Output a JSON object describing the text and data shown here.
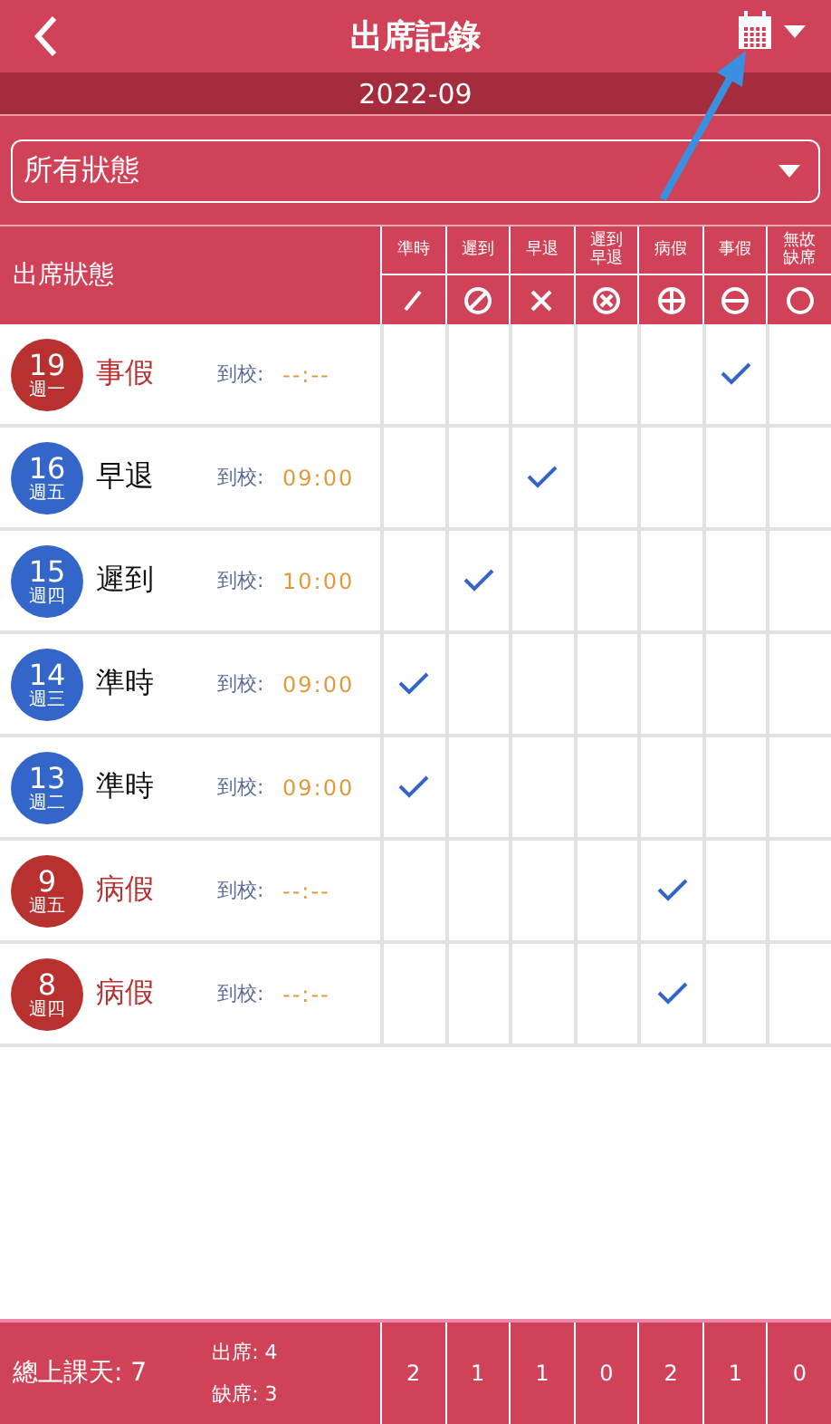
{
  "header": {
    "title": "出席記錄"
  },
  "month": "2022-09",
  "filter": {
    "value": "所有狀態"
  },
  "table": {
    "status_heading": "出席狀態",
    "columns": [
      {
        "label": "準時",
        "kind": "slash"
      },
      {
        "label": "遲到",
        "kind": "prohibit"
      },
      {
        "label": "早退",
        "kind": "cross"
      },
      {
        "label": "遲到早退",
        "kind": "circlecross"
      },
      {
        "label": "病假",
        "kind": "circleplus"
      },
      {
        "label": "事假",
        "kind": "circleminus"
      },
      {
        "label": "無故缺席",
        "kind": "circle"
      }
    ],
    "rows": [
      {
        "day": "19",
        "weekday": "週一",
        "status": "事假",
        "kind": "leave",
        "color": "#b8312f",
        "arrive_label": "到校:",
        "arrive_time": "--:--",
        "marks": [
          false,
          false,
          false,
          false,
          false,
          true,
          false
        ]
      },
      {
        "day": "16",
        "weekday": "週五",
        "status": "早退",
        "kind": "present",
        "color": "#3465c9",
        "arrive_label": "到校:",
        "arrive_time": "09:00",
        "marks": [
          false,
          false,
          true,
          false,
          false,
          false,
          false
        ]
      },
      {
        "day": "15",
        "weekday": "週四",
        "status": "遲到",
        "kind": "present",
        "color": "#3465c9",
        "arrive_label": "到校:",
        "arrive_time": "10:00",
        "marks": [
          false,
          true,
          false,
          false,
          false,
          false,
          false
        ]
      },
      {
        "day": "14",
        "weekday": "週三",
        "status": "準時",
        "kind": "present",
        "color": "#3465c9",
        "arrive_label": "到校:",
        "arrive_time": "09:00",
        "marks": [
          true,
          false,
          false,
          false,
          false,
          false,
          false
        ]
      },
      {
        "day": "13",
        "weekday": "週二",
        "status": "準時",
        "kind": "present",
        "color": "#3465c9",
        "arrive_label": "到校:",
        "arrive_time": "09:00",
        "marks": [
          true,
          false,
          false,
          false,
          false,
          false,
          false
        ]
      },
      {
        "day": "9",
        "weekday": "週五",
        "status": "病假",
        "kind": "leave",
        "color": "#b8312f",
        "arrive_label": "到校:",
        "arrive_time": "--:--",
        "marks": [
          false,
          false,
          false,
          false,
          true,
          false,
          false
        ]
      },
      {
        "day": "8",
        "weekday": "週四",
        "status": "病假",
        "kind": "leave",
        "color": "#b8312f",
        "arrive_label": "到校:",
        "arrive_time": "--:--",
        "marks": [
          false,
          false,
          false,
          false,
          true,
          false,
          false
        ]
      }
    ]
  },
  "footer": {
    "total": "總上課天: 7",
    "present": "出席: 4",
    "absent": "缺席: 3",
    "counts": [
      "2",
      "1",
      "1",
      "0",
      "2",
      "1",
      "0"
    ]
  }
}
